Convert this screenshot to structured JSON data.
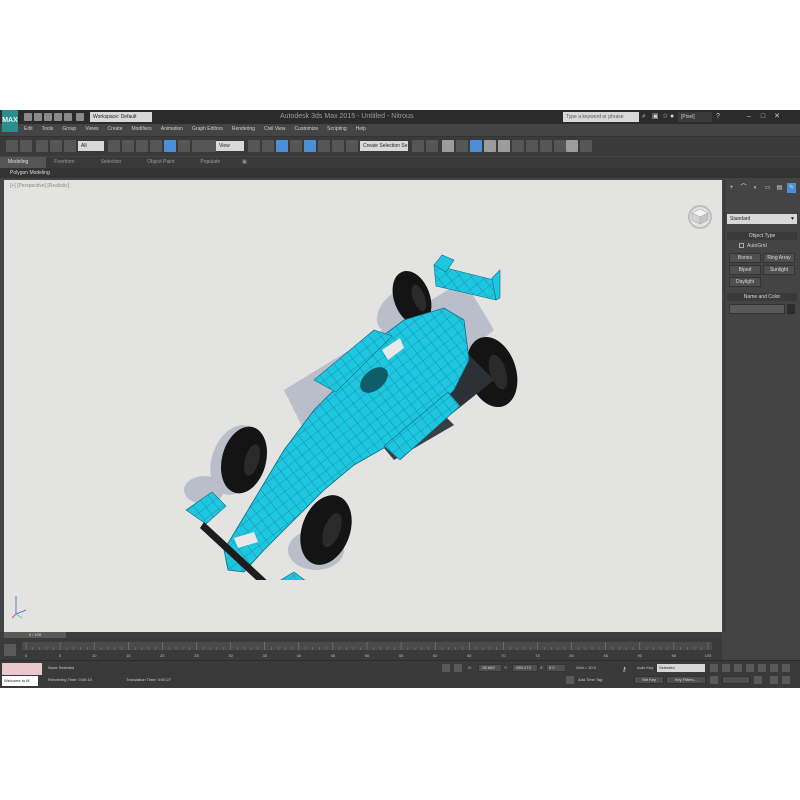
{
  "window": {
    "app_logo": "MAX",
    "workspace": "Workspace: Default",
    "title": "Autodesk 3ds Max 2015 - Untitled - Nitrous",
    "search_placeholder": "Type a keyword or phrase",
    "user": "[Pixel]",
    "minimize": "–",
    "maximize": "□",
    "close": "✕"
  },
  "menu": {
    "items": [
      "Edit",
      "Tools",
      "Group",
      "Views",
      "Create",
      "Modifiers",
      "Animation",
      "Graph Editors",
      "Rendering",
      "Civil View",
      "Customize",
      "Scripting",
      "Help"
    ]
  },
  "toolbar": {
    "selection_filter": "All",
    "ref_coord": "View",
    "named_selection": "Create Selection Se"
  },
  "ribbon": {
    "tabs": [
      "Modeling",
      "Freeform",
      "Selection",
      "Object Paint",
      "Populate"
    ],
    "active_tab": "Modeling",
    "sub_label": "Polygon Modeling"
  },
  "viewport": {
    "label": "[+] [Perspective] [Realistic]",
    "car_color": "#1ec6e0",
    "wire_color": "#0b6f80",
    "tire_color": "#141414",
    "shadow_color": "#b4b7c6"
  },
  "command_panel": {
    "tabs": [
      "+",
      "⌒",
      "◐",
      "▭",
      "▤",
      "✎"
    ],
    "category": "Standard",
    "object_type_title": "Object Type",
    "autogrid_label": "AutoGrid",
    "buttons": [
      "Bones",
      "Ring Array",
      "Biped",
      "Sunlight",
      "Daylight"
    ],
    "name_color_title": "Name and Color"
  },
  "timeline": {
    "frame_label": "0 / 100",
    "ticks": [
      "0",
      "5",
      "10",
      "15",
      "20",
      "25",
      "30",
      "35",
      "40",
      "45",
      "50",
      "55",
      "60",
      "65",
      "70",
      "75",
      "80",
      "85",
      "90",
      "95",
      "100"
    ]
  },
  "status": {
    "maxscript_input": "Welcome to M",
    "selection_text": "None Selected",
    "render_time": "Rendering Time: 0:00:10",
    "translation_time": "Translation Time: 0:00:27",
    "x_value": "-95.669",
    "y_value": "-590.273",
    "z_value": "0.0",
    "grid": "Grid = 10.0",
    "add_time_tag": "Add Time Tag",
    "autokey": "Auto Key",
    "selected_dd": "Selected",
    "setkey": "Set Key",
    "key_filters": "Key Filters..."
  }
}
